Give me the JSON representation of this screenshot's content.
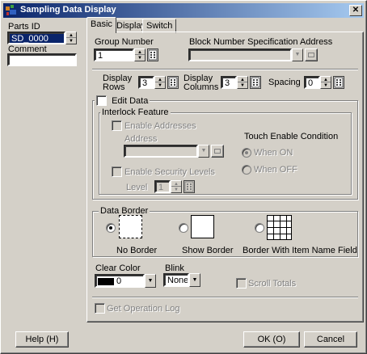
{
  "window": {
    "title": "Sampling Data Display",
    "close_label": "✕"
  },
  "left": {
    "parts_id_label": "Parts ID",
    "parts_id_value": "SD_0000",
    "comment_label": "Comment",
    "comment_value": ""
  },
  "tabs": [
    {
      "label": "Basic"
    },
    {
      "label": "Display"
    },
    {
      "label": "Switch"
    }
  ],
  "basic": {
    "group_number_label": "Group Number",
    "group_number_value": "1",
    "block_number_label": "Block Number Specification Address",
    "block_number_value": "",
    "display_rows_label_1": "Display",
    "display_rows_label_2": "Rows",
    "display_rows_value": "3",
    "display_columns_label_1": "Display",
    "display_columns_label_2": "Columns",
    "display_columns_value": "3",
    "spacing_label": "Spacing",
    "spacing_value": "0",
    "edit_data_label": "Edit Data",
    "interlock_label": "Interlock Feature",
    "enable_addresses_label": "Enable Addresses",
    "address_label": "Address",
    "address_value": "",
    "touch_enable_label": "Touch Enable Condition",
    "when_on_label": "When ON",
    "when_off_label": "When OFF",
    "enable_security_label": "Enable Security Levels",
    "level_label": "Level",
    "level_value": "1",
    "data_border_label": "Data Border",
    "border_options": [
      {
        "label": "No Border"
      },
      {
        "label": "Show Border"
      },
      {
        "label": "Border  With Item  Name Field"
      }
    ],
    "clear_color_label": "Clear Color",
    "clear_color_value": "0",
    "clear_color_swatch": "#000000",
    "blink_label": "Blink",
    "blink_value": "None",
    "scroll_totals_label": "Scroll Totals",
    "get_operation_log_label": "Get Operation Log"
  },
  "footer": {
    "help_label": "Help (H)",
    "ok_label": "OK (O)",
    "cancel_label": "Cancel"
  }
}
